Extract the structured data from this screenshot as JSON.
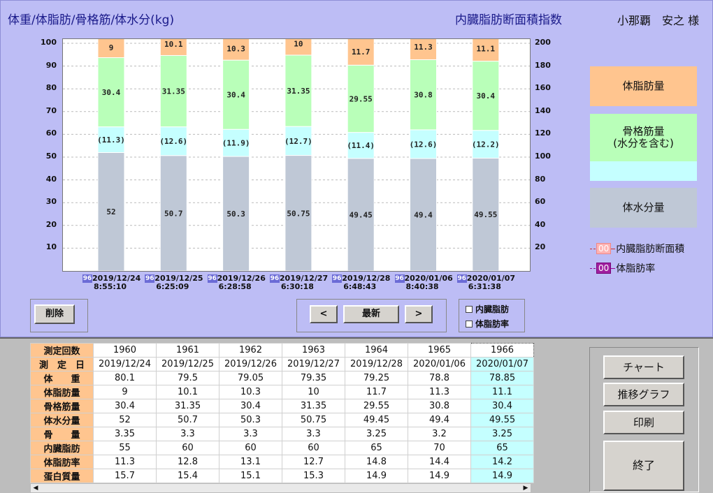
{
  "header": {
    "left_title": "体重/体脂肪/骨格筋/体水分(kg)",
    "right_title": "内臓脂肪断面積指数",
    "user": "小那覇　安之 様"
  },
  "colors": {
    "fat": "#ffc58f",
    "muscle": "#b9ffb9",
    "water": "#c5ffff",
    "bone": "#bfc8d6"
  },
  "chart_data": {
    "type": "bar",
    "stacked": true,
    "ylim": [
      0,
      100
    ],
    "y2lim": [
      0,
      200
    ],
    "yticks": [
      "100",
      "90",
      "80",
      "70",
      "60",
      "50",
      "40",
      "30",
      "20",
      "10"
    ],
    "y2ticks": [
      "200",
      "180",
      "160",
      "140",
      "120",
      "100",
      "80",
      "60",
      "40",
      "20"
    ],
    "grid": true,
    "categories": [
      "2019/12/24",
      "2019/12/25",
      "2019/12/26",
      "2019/12/27",
      "2019/12/28",
      "2020/01/06",
      "2020/01/07"
    ],
    "times": [
      "8:55:10",
      "6:25:09",
      "6:28:58",
      "6:30:18",
      "6:48:43",
      "8:40:38",
      "6:31:38"
    ],
    "badge": "96",
    "series": [
      {
        "name": "体水分量",
        "values": [
          52,
          50.7,
          50.3,
          50.75,
          49.45,
          49.4,
          49.55
        ],
        "labels": [
          "52",
          "50.7",
          "50.3",
          "50.75",
          "49.45",
          "49.4",
          "49.55"
        ]
      },
      {
        "name": "",
        "values": [
          11.3,
          12.6,
          11.9,
          12.7,
          11.4,
          12.6,
          12.2
        ],
        "labels": [
          "(11.3)",
          "(12.6)",
          "(11.9)",
          "(12.7)",
          "(11.4)",
          "(12.6)",
          "(12.2)"
        ]
      },
      {
        "name": "骨格筋量",
        "values": [
          30.4,
          31.35,
          30.4,
          31.35,
          29.55,
          30.8,
          30.4
        ],
        "labels": [
          "30.4",
          "31.35",
          "30.4",
          "31.35",
          "29.55",
          "30.8",
          "30.4"
        ]
      },
      {
        "name": "体脂肪量",
        "values": [
          9,
          10.1,
          10.3,
          10,
          11.7,
          11.3,
          11.1
        ],
        "labels": [
          "9",
          "10.1",
          "10.3",
          "10",
          "11.7",
          "11.3",
          "11.1"
        ]
      }
    ]
  },
  "legend": {
    "fat": "体脂肪量",
    "muscle": "骨格筋量\n(水分を含む)",
    "water": "体水分量",
    "visceral_badge": "00",
    "visceral": "内臓脂肪断面積",
    "fat_rate_badge": "00",
    "fat_rate": "体脂肪率"
  },
  "controls": {
    "delete": "削除",
    "prev": "<",
    "latest": "最新",
    "next": ">",
    "chk_visceral": "内臓脂肪",
    "chk_fat_rate": "体脂肪率"
  },
  "table": {
    "rows": [
      {
        "label": "測定回数",
        "values": [
          "1960",
          "1961",
          "1962",
          "1963",
          "1964",
          "1965",
          "1966"
        ]
      },
      {
        "label": "測　定　日",
        "values": [
          "2019/12/24",
          "2019/12/25",
          "2019/12/26",
          "2019/12/27",
          "2019/12/28",
          "2020/01/06",
          "2020/01/07"
        ]
      },
      {
        "label": "体　　重",
        "values": [
          "80.1",
          "79.5",
          "79.05",
          "79.35",
          "79.25",
          "78.8",
          "78.85"
        ]
      },
      {
        "label": "体脂肪量",
        "values": [
          "9",
          "10.1",
          "10.3",
          "10",
          "11.7",
          "11.3",
          "11.1"
        ]
      },
      {
        "label": "骨格筋量",
        "values": [
          "30.4",
          "31.35",
          "30.4",
          "31.35",
          "29.55",
          "30.8",
          "30.4"
        ]
      },
      {
        "label": "体水分量",
        "values": [
          "52",
          "50.7",
          "50.3",
          "50.75",
          "49.45",
          "49.4",
          "49.55"
        ]
      },
      {
        "label": "骨　　量",
        "values": [
          "3.35",
          "3.3",
          "3.3",
          "3.3",
          "3.25",
          "3.2",
          "3.25"
        ]
      },
      {
        "label": "内臓脂肪",
        "values": [
          "55",
          "60",
          "60",
          "60",
          "65",
          "70",
          "65"
        ]
      },
      {
        "label": "体脂肪率",
        "values": [
          "11.3",
          "12.8",
          "13.1",
          "12.7",
          "14.8",
          "14.4",
          "14.2"
        ]
      },
      {
        "label": "蛋白質量",
        "values": [
          "15.7",
          "15.4",
          "15.1",
          "15.3",
          "14.9",
          "14.9",
          "14.9"
        ]
      }
    ]
  },
  "side_buttons": {
    "chart": "チャート",
    "trend": "推移グラフ",
    "print": "印刷",
    "exit": "終了"
  }
}
